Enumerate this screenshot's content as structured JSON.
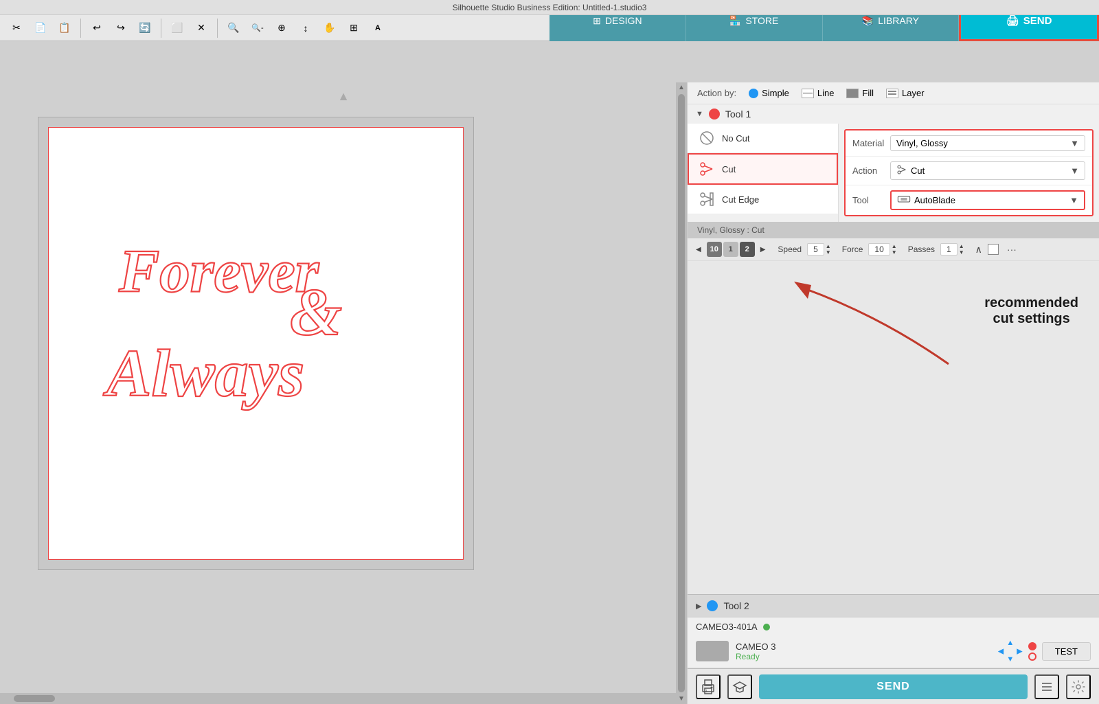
{
  "app": {
    "title": "Silhouette Studio Business Edition: Untitled-1.studio3"
  },
  "nav": {
    "design": "DESIGN",
    "store": "STORE",
    "library": "LIBRARY",
    "send": "SEND"
  },
  "toolbar": {
    "tools": [
      "✂",
      "📄",
      "📋",
      "↩",
      "↪",
      "🔄",
      "⬜",
      "✕",
      "🔍+",
      "🔍-",
      "⊕",
      "↕",
      "✋",
      "⊞",
      "⌫"
    ]
  },
  "right_panel": {
    "action_by_label": "Action by:",
    "action_options": [
      "Simple",
      "Line",
      "Fill",
      "Layer"
    ],
    "tool1_label": "Tool 1",
    "tool2_label": "Tool 2",
    "cut_options": [
      {
        "id": "no_cut",
        "label": "No Cut",
        "active": false
      },
      {
        "id": "cut",
        "label": "Cut",
        "active": true,
        "highlighted": true
      },
      {
        "id": "cut_edge",
        "label": "Cut Edge",
        "active": false
      }
    ],
    "material_label": "Material",
    "material_value": "Vinyl, Glossy",
    "action_label": "Action",
    "action_value": "Cut",
    "tool_label": "Tool",
    "tool_value": "AutoBlade",
    "vinyl_strip_label": "Vinyl, Glossy : Cut",
    "blade_nums": [
      "10",
      "1",
      "2"
    ],
    "speed_label": "Speed",
    "speed_value": "5",
    "force_label": "Force",
    "force_value": "10",
    "passes_label": "Passes",
    "passes_value": "1"
  },
  "annotation": {
    "line1": "recommended",
    "line2": "cut settings"
  },
  "device": {
    "id": "CAMEO3-401A",
    "name": "CAMEO 3",
    "status": "Ready",
    "test_label": "TEST"
  },
  "bottom_bar": {
    "send_label": "SEND"
  },
  "icons": {
    "cut_icon": "✂",
    "no_cut_icon": "⊘",
    "cut_edge_icon": "✂",
    "printer_icon": "🖨",
    "grad_icon": "🎓",
    "settings_icon": "⚙",
    "list_icon": "≡",
    "nav_icon": "✈"
  }
}
